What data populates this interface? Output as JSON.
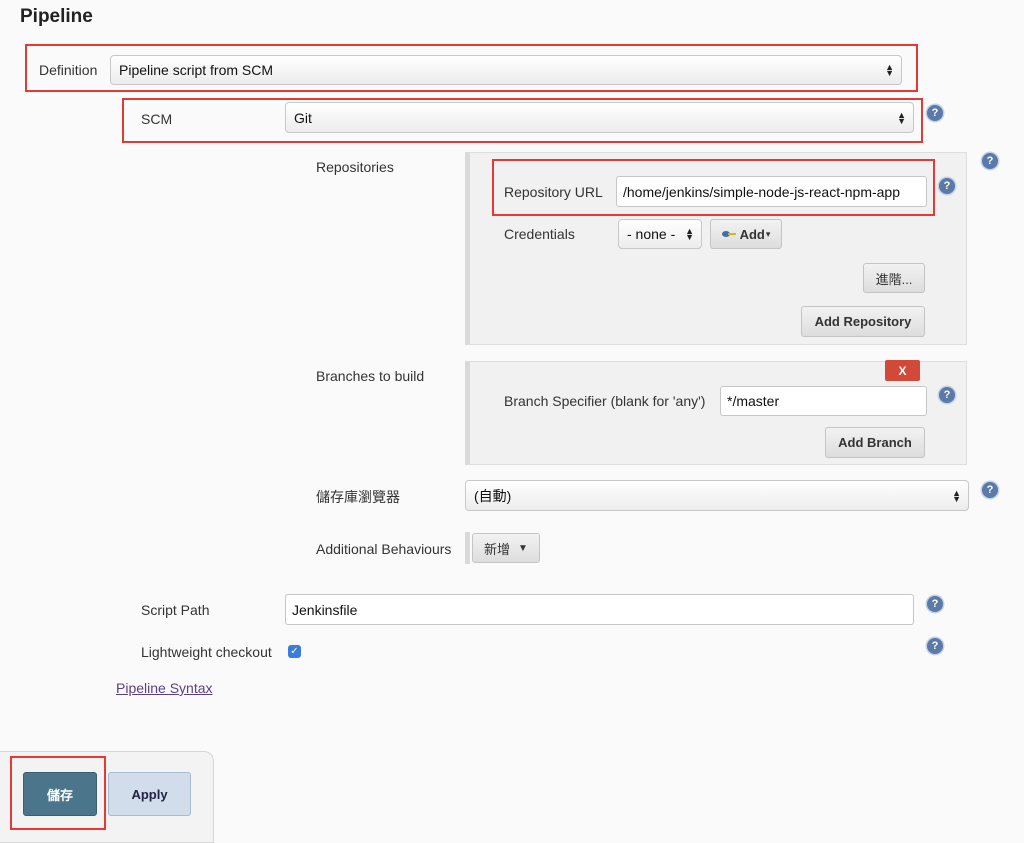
{
  "section": {
    "title": "Pipeline"
  },
  "definition": {
    "label": "Definition",
    "value": "Pipeline script from SCM"
  },
  "scm": {
    "label": "SCM",
    "value": "Git"
  },
  "repositories": {
    "label": "Repositories",
    "url_label": "Repository URL",
    "url_value": "/home/jenkins/simple-node-js-react-npm-app",
    "credentials_label": "Credentials",
    "credentials_value": "- none -",
    "add_label": "Add",
    "advanced_label": "進階...",
    "add_repository_label": "Add Repository"
  },
  "branches": {
    "label": "Branches to build",
    "remove_label": "X",
    "specifier_label": "Branch Specifier (blank for 'any')",
    "specifier_value": "*/master",
    "add_branch_label": "Add Branch"
  },
  "repo_browser": {
    "label": "儲存庫瀏覽器",
    "value": "(自動)"
  },
  "additional_behaviours": {
    "label": "Additional Behaviours",
    "add_label": "新增"
  },
  "script_path": {
    "label": "Script Path",
    "value": "Jenkinsfile"
  },
  "lightweight_checkout": {
    "label": "Lightweight checkout",
    "checked": true
  },
  "pipeline_syntax": {
    "label": "Pipeline Syntax"
  },
  "footer": {
    "save_label": "儲存",
    "apply_label": "Apply"
  },
  "icons": {
    "help": "question-mark-icon",
    "credentials_add": "key-icon",
    "dropdown": "chevron-down-icon"
  },
  "colors": {
    "highlight": "#e53935",
    "save": "#4b758b",
    "apply": "#d1ddeb",
    "remove": "#d24939",
    "help": "#5c7aa8"
  }
}
